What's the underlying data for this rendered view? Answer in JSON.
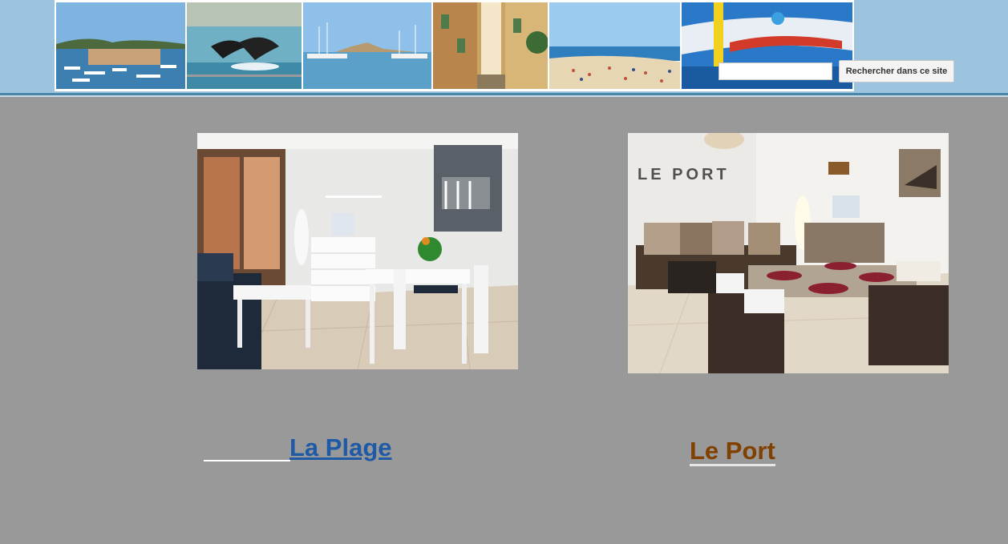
{
  "header": {
    "banner_images": [
      {
        "name": "antibes-harbor-photo"
      },
      {
        "name": "dolphins-photo"
      },
      {
        "name": "port-vauban-photo"
      },
      {
        "name": "old-town-alley-photo"
      },
      {
        "name": "beach-photo"
      },
      {
        "name": "fishing-boat-photo"
      }
    ],
    "search": {
      "input_value": "",
      "button_label": "Rechercher dans ce site"
    }
  },
  "listings": [
    {
      "title": "La Plage",
      "photo_label": "",
      "link_color": "#1f5aa6"
    },
    {
      "title": "Le Port",
      "photo_label": "LE PORT",
      "link_color": "#804000"
    }
  ],
  "colors": {
    "page_background": "#999999",
    "header_background": "#9cc4de"
  }
}
